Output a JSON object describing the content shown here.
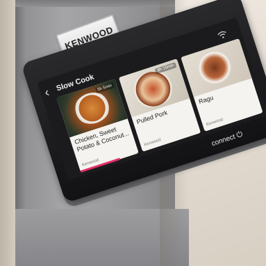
{
  "brand": {
    "logo_text": "KENWOOD",
    "connect_label": "connect"
  },
  "screen": {
    "section_title": "Slow Cook",
    "cards": [
      {
        "title": "Chicken, Sweet Potato & Coconut...",
        "time": "5h 5min",
        "meta": "Kenwood"
      },
      {
        "title": "Pulled Pork",
        "time": "8h 15min",
        "meta": "Kenwood"
      },
      {
        "title": "Ragu",
        "time": "",
        "meta": "Kenwood"
      }
    ]
  },
  "colors": {
    "accent": "#e22e6a",
    "screen_bg": "#1b1b1d",
    "card_bg": "#f5f3ef"
  },
  "icons": {
    "back": "chevron-left-icon",
    "wifi": "wifi-icon",
    "connect": "power-icon"
  }
}
